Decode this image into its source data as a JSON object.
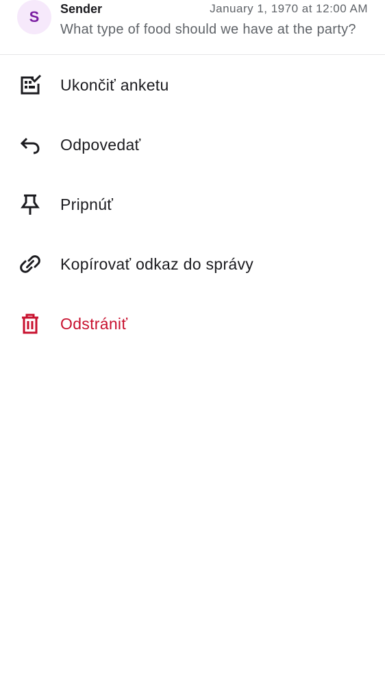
{
  "header": {
    "avatar_letter": "S",
    "sender": "Sender",
    "timestamp": "January 1, 1970 at 12:00 AM",
    "preview": "What type of food should we have at the party?"
  },
  "menu": {
    "items": [
      {
        "label": "Ukončiť anketu",
        "icon": "end-poll-icon"
      },
      {
        "label": "Odpovedať",
        "icon": "reply-icon"
      },
      {
        "label": "Pripnúť",
        "icon": "pin-icon"
      },
      {
        "label": "Kopírovať odkaz do správy",
        "icon": "link-icon"
      },
      {
        "label": "Odstrániť",
        "icon": "trash-icon"
      }
    ]
  },
  "colors": {
    "avatar_bg": "#f6e9fb",
    "avatar_fg": "#7b1fa2",
    "text_primary": "#1b1b1f",
    "text_secondary": "#5f6368",
    "danger": "#c8102e"
  }
}
